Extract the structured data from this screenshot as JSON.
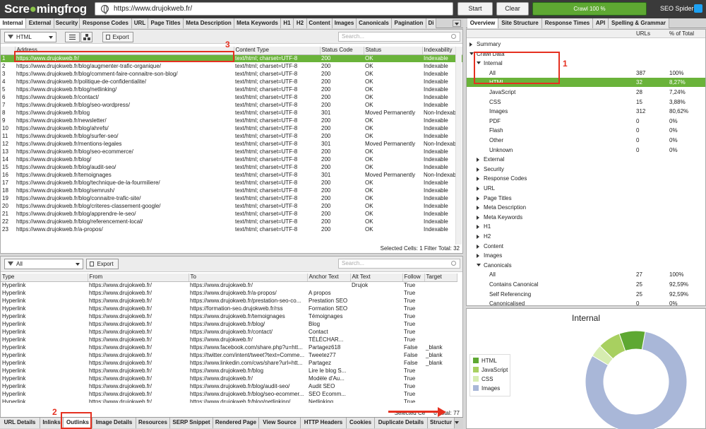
{
  "app": {
    "logo_part1": "Scre",
    "logo_part2": "mingfrog",
    "url": "https://www.drujokweb.fr/",
    "start_label": "Start",
    "clear_label": "Clear",
    "progress_label": "Crawl 100 %",
    "progress_value": 1.0,
    "product_label": "SEO Spider"
  },
  "main_tabs": [
    "Internal",
    "External",
    "Security",
    "Response Codes",
    "URL",
    "Page Titles",
    "Meta Description",
    "Meta Keywords",
    "H1",
    "H2",
    "Content",
    "Images",
    "Canonicals",
    "Pagination",
    "Di"
  ],
  "right_tabs": [
    "Overview",
    "Site Structure",
    "Response Times",
    "API",
    "Spelling & Grammar"
  ],
  "top_toolbar": {
    "filter_value": "HTML",
    "export_label": "Export",
    "search_placeholder": "Search..."
  },
  "top_table": {
    "headers": [
      "",
      "Address",
      "Content Type",
      "Status Code",
      "Status",
      "Indexability"
    ],
    "rows": [
      [
        "1",
        "https://www.drujokweb.fr/",
        "text/html; charset=UTF-8",
        "200",
        "OK",
        "Indexable"
      ],
      [
        "2",
        "https://www.drujokweb.fr/blog/augmenter-trafic-organique/",
        "text/html; charset=UTF-8",
        "200",
        "OK",
        "Indexable"
      ],
      [
        "3",
        "https://www.drujokweb.fr/blog/comment-faire-connaitre-son-blog/",
        "text/html; charset=UTF-8",
        "200",
        "OK",
        "Indexable"
      ],
      [
        "4",
        "https://www.drujokweb.fr/politique-de-confidentialite/",
        "text/html; charset=UTF-8",
        "200",
        "OK",
        "Indexable"
      ],
      [
        "5",
        "https://www.drujokweb.fr/blog/netlinking/",
        "text/html; charset=UTF-8",
        "200",
        "OK",
        "Indexable"
      ],
      [
        "6",
        "https://www.drujokweb.fr/contact/",
        "text/html; charset=UTF-8",
        "200",
        "OK",
        "Indexable"
      ],
      [
        "7",
        "https://www.drujokweb.fr/blog/seo-wordpress/",
        "text/html; charset=UTF-8",
        "200",
        "OK",
        "Indexable"
      ],
      [
        "8",
        "https://www.drujokweb.fr/blog",
        "text/html; charset=UTF-8",
        "301",
        "Moved Permanently",
        "Non-Indexab"
      ],
      [
        "9",
        "https://www.drujokweb.fr/newsletter/",
        "text/html; charset=UTF-8",
        "200",
        "OK",
        "Indexable"
      ],
      [
        "10",
        "https://www.drujokweb.fr/blog/ahrefs/",
        "text/html; charset=UTF-8",
        "200",
        "OK",
        "Indexable"
      ],
      [
        "11",
        "https://www.drujokweb.fr/blog/surfer-seo/",
        "text/html; charset=UTF-8",
        "200",
        "OK",
        "Indexable"
      ],
      [
        "12",
        "https://www.drujokweb.fr/mentions-legales",
        "text/html; charset=UTF-8",
        "301",
        "Moved Permanently",
        "Non-Indexab"
      ],
      [
        "13",
        "https://www.drujokweb.fr/blog/seo-ecommerce/",
        "text/html; charset=UTF-8",
        "200",
        "OK",
        "Indexable"
      ],
      [
        "14",
        "https://www.drujokweb.fr/blog/",
        "text/html; charset=UTF-8",
        "200",
        "OK",
        "Indexable"
      ],
      [
        "15",
        "https://www.drujokweb.fr/blog/audit-seo/",
        "text/html; charset=UTF-8",
        "200",
        "OK",
        "Indexable"
      ],
      [
        "16",
        "https://www.drujokweb.fr/temoignages",
        "text/html; charset=UTF-8",
        "301",
        "Moved Permanently",
        "Non-Indexab"
      ],
      [
        "17",
        "https://www.drujokweb.fr/blog/technique-de-la-fourmiliere/",
        "text/html; charset=UTF-8",
        "200",
        "OK",
        "Indexable"
      ],
      [
        "18",
        "https://www.drujokweb.fr/blog/semrush/",
        "text/html; charset=UTF-8",
        "200",
        "OK",
        "Indexable"
      ],
      [
        "19",
        "https://www.drujokweb.fr/blog/connaitre-trafic-site/",
        "text/html; charset=UTF-8",
        "200",
        "OK",
        "Indexable"
      ],
      [
        "20",
        "https://www.drujokweb.fr/blog/criteres-classement-google/",
        "text/html; charset=UTF-8",
        "200",
        "OK",
        "Indexable"
      ],
      [
        "21",
        "https://www.drujokweb.fr/blog/apprendre-le-seo/",
        "text/html; charset=UTF-8",
        "200",
        "OK",
        "Indexable"
      ],
      [
        "22",
        "https://www.drujokweb.fr/blog/referencement-local/",
        "text/html; charset=UTF-8",
        "200",
        "OK",
        "Indexable"
      ],
      [
        "23",
        "https://www.drujokweb.fr/a-propos/",
        "text/html; charset=UTF-8",
        "200",
        "OK",
        "Indexable"
      ]
    ],
    "status_bar": "Selected Cells: 1  Filter Total: 32"
  },
  "bottom_toolbar": {
    "filter_value": "All",
    "export_label": "Export",
    "search_placeholder": "Search..."
  },
  "bottom_table": {
    "headers": [
      "Type",
      "From",
      "To",
      "Anchor Text",
      "Alt Text",
      "Follow",
      "Target"
    ],
    "rows": [
      [
        "Hyperlink",
        "https://www.drujokweb.fr/",
        "https://www.drujokweb.fr/",
        "",
        "Drujok",
        "True",
        ""
      ],
      [
        "Hyperlink",
        "https://www.drujokweb.fr/",
        "https://www.drujokweb.fr/a-propos/",
        "A propos",
        "",
        "True",
        ""
      ],
      [
        "Hyperlink",
        "https://www.drujokweb.fr/",
        "https://www.drujokweb.fr/prestation-seo-co...",
        "Prestation SEO",
        "",
        "True",
        ""
      ],
      [
        "Hyperlink",
        "https://www.drujokweb.fr/",
        "https://formation-seo.drujokweb.fr/rss",
        "Formation SEO",
        "",
        "True",
        ""
      ],
      [
        "Hyperlink",
        "https://www.drujokweb.fr/",
        "https://www.drujokweb.fr/temoignages",
        "Témoignages",
        "",
        "True",
        ""
      ],
      [
        "Hyperlink",
        "https://www.drujokweb.fr/",
        "https://www.drujokweb.fr/blog/",
        "Blog",
        "",
        "True",
        ""
      ],
      [
        "Hyperlink",
        "https://www.drujokweb.fr/",
        "https://www.drujokweb.fr/contact/",
        "Contact",
        "",
        "True",
        ""
      ],
      [
        "Hyperlink",
        "https://www.drujokweb.fr/",
        "https://www.drujokweb.fr/",
        "TÉLÉCHAR...",
        "",
        "True",
        ""
      ],
      [
        "Hyperlink",
        "https://www.drujokweb.fr/",
        "https://www.facebook.com/share.php?u=htt...",
        "Partagez618",
        "",
        "False",
        "_blank"
      ],
      [
        "Hyperlink",
        "https://www.drujokweb.fr/",
        "https://twitter.com/intent/tweet?text=Comme...",
        "Tweetez77",
        "",
        "False",
        "_blank"
      ],
      [
        "Hyperlink",
        "https://www.drujokweb.fr/",
        "https://www.linkedin.com/cws/share?url=htt...",
        "Partagez",
        "",
        "False",
        "_blank"
      ],
      [
        "Hyperlink",
        "https://www.drujokweb.fr/",
        "https://www.drujokweb.fr/blog",
        "Lire le blog S...",
        "",
        "True",
        ""
      ],
      [
        "Hyperlink",
        "https://www.drujokweb.fr/",
        "https://www.drujokweb.fr/",
        "Modèle d'Au...",
        "",
        "True",
        ""
      ],
      [
        "Hyperlink",
        "https://www.drujokweb.fr/",
        "https://www.drujokweb.fr/blog/audit-seo/",
        "Audit SEO",
        "",
        "True",
        ""
      ],
      [
        "Hyperlink",
        "https://www.drujokweb.fr/",
        "https://www.drujokweb.fr/blog/seo-ecommer...",
        "SEO Ecomm...",
        "",
        "True",
        ""
      ],
      [
        "Hyperlink",
        "https://www.drujokweb.fr/",
        "https://www.drujokweb.fr/blog/netlinking/",
        "Netlinking",
        "",
        "True",
        ""
      ]
    ],
    "status_prefix": "Selected Ce",
    "status_suffix": "0  Total: 77"
  },
  "bottom_tabs": [
    "URL Details",
    "Inlinks",
    "Outlinks",
    "Image Details",
    "Resources",
    "SERP Snippet",
    "Rendered Page",
    "View Source",
    "HTTP Headers",
    "Cookies",
    "Duplicate Details",
    "Structur"
  ],
  "overview": {
    "col_urls": "URLs",
    "col_pct": "% of Total",
    "rows": [
      {
        "label": "Summary",
        "level": 0,
        "tri": "r",
        "urls": "",
        "pct": ""
      },
      {
        "label": "Crawl Data",
        "level": 0,
        "tri": "d",
        "urls": "",
        "pct": ""
      },
      {
        "label": "Internal",
        "level": 1,
        "tri": "d",
        "urls": "",
        "pct": ""
      },
      {
        "label": "All",
        "level": 2,
        "tri": "",
        "urls": "387",
        "pct": "100%"
      },
      {
        "label": "HTML",
        "level": 2,
        "tri": "",
        "urls": "32",
        "pct": "8,27%",
        "selected": true
      },
      {
        "label": "JavaScript",
        "level": 2,
        "tri": "",
        "urls": "28",
        "pct": "7,24%"
      },
      {
        "label": "CSS",
        "level": 2,
        "tri": "",
        "urls": "15",
        "pct": "3,88%"
      },
      {
        "label": "Images",
        "level": 2,
        "tri": "",
        "urls": "312",
        "pct": "80,62%"
      },
      {
        "label": "PDF",
        "level": 2,
        "tri": "",
        "urls": "0",
        "pct": "0%"
      },
      {
        "label": "Flash",
        "level": 2,
        "tri": "",
        "urls": "0",
        "pct": "0%"
      },
      {
        "label": "Other",
        "level": 2,
        "tri": "",
        "urls": "0",
        "pct": "0%"
      },
      {
        "label": "Unknown",
        "level": 2,
        "tri": "",
        "urls": "0",
        "pct": "0%"
      },
      {
        "label": "External",
        "level": 1,
        "tri": "r",
        "urls": "",
        "pct": ""
      },
      {
        "label": "Security",
        "level": 1,
        "tri": "r",
        "urls": "",
        "pct": ""
      },
      {
        "label": "Response Codes",
        "level": 1,
        "tri": "r",
        "urls": "",
        "pct": ""
      },
      {
        "label": "URL",
        "level": 1,
        "tri": "r",
        "urls": "",
        "pct": ""
      },
      {
        "label": "Page Titles",
        "level": 1,
        "tri": "r",
        "urls": "",
        "pct": ""
      },
      {
        "label": "Meta Description",
        "level": 1,
        "tri": "r",
        "urls": "",
        "pct": ""
      },
      {
        "label": "Meta Keywords",
        "level": 1,
        "tri": "r",
        "urls": "",
        "pct": ""
      },
      {
        "label": "H1",
        "level": 1,
        "tri": "r",
        "urls": "",
        "pct": ""
      },
      {
        "label": "H2",
        "level": 1,
        "tri": "r",
        "urls": "",
        "pct": ""
      },
      {
        "label": "Content",
        "level": 1,
        "tri": "r",
        "urls": "",
        "pct": ""
      },
      {
        "label": "Images",
        "level": 1,
        "tri": "r",
        "urls": "",
        "pct": ""
      },
      {
        "label": "Canonicals",
        "level": 1,
        "tri": "d",
        "urls": "",
        "pct": ""
      },
      {
        "label": "All",
        "level": 2,
        "tri": "",
        "urls": "27",
        "pct": "100%"
      },
      {
        "label": "Contains Canonical",
        "level": 2,
        "tri": "",
        "urls": "25",
        "pct": "92,59%"
      },
      {
        "label": "Self Referencing",
        "level": 2,
        "tri": "",
        "urls": "25",
        "pct": "92,59%"
      },
      {
        "label": "Canonicalised",
        "level": 2,
        "tri": "",
        "urls": "0",
        "pct": "0%"
      }
    ]
  },
  "annotations": {
    "label1": "1",
    "label2": "2",
    "label3": "3"
  },
  "chart_data": {
    "type": "pie",
    "title": "Internal",
    "categories": [
      "HTML",
      "JavaScript",
      "CSS",
      "Images"
    ],
    "values": [
      32,
      28,
      15,
      312
    ],
    "colors": [
      "#5ea832",
      "#a8d060",
      "#d6ecb0",
      "#a9b7d8"
    ],
    "legend_position": "left"
  }
}
